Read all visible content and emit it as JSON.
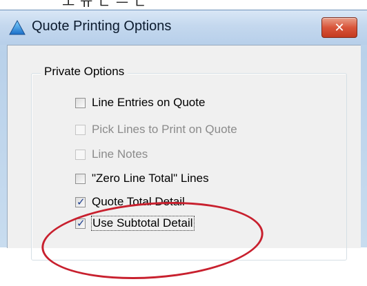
{
  "window": {
    "title": "Quote Printing Options",
    "close_label": "✕"
  },
  "group": {
    "legend": "Private Options"
  },
  "options": [
    {
      "label": "Line Entries on Quote",
      "checked": false,
      "enabled": true
    },
    {
      "label": "Pick Lines to Print on Quote",
      "checked": false,
      "enabled": false
    },
    {
      "label": "Line Notes",
      "checked": false,
      "enabled": false
    },
    {
      "label": "\"Zero Line Total\" Lines",
      "checked": false,
      "enabled": true
    },
    {
      "label": "Quote Total Detail",
      "checked": true,
      "enabled": true
    },
    {
      "label": "Use Subtotal Detail",
      "checked": true,
      "enabled": true
    }
  ],
  "icons": {
    "app": "triangle-app-icon",
    "close": "close-icon"
  },
  "colors": {
    "annotation": "#c8202e",
    "close_button": "#d9553a",
    "disabled_text": "#8b8b8b"
  }
}
